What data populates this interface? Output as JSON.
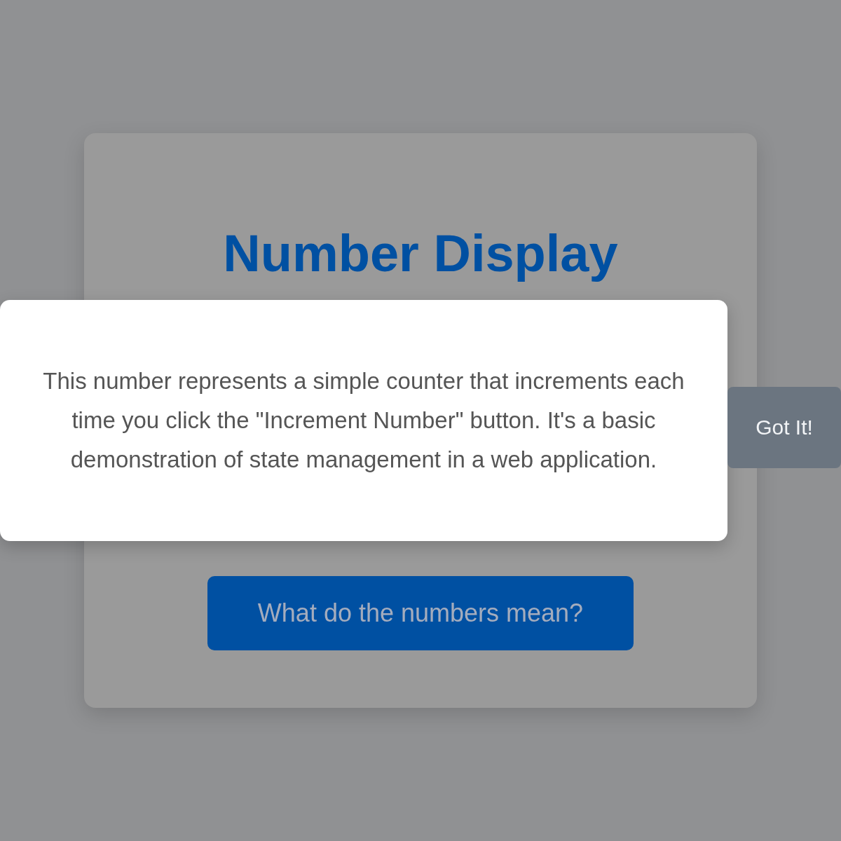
{
  "card": {
    "title": "Number Display",
    "button": "What do the numbers mean?"
  },
  "dialog": {
    "text": "This number represents a simple counter that increments each time you click the \"Increment Number\" button. It's a basic demonstration of state management in a web application.",
    "button": "Got It!"
  }
}
